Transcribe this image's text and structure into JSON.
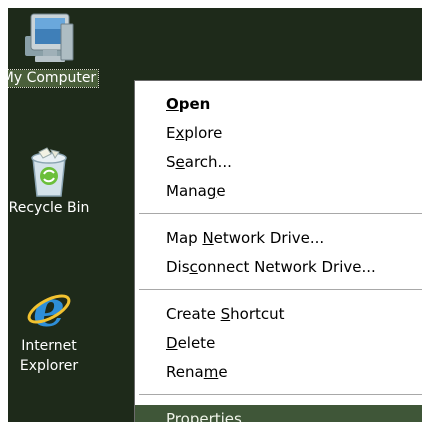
{
  "desktop": {
    "icons": [
      {
        "name": "my-computer",
        "label": "My Computer",
        "selected": true
      },
      {
        "name": "recycle-bin",
        "label": "Recycle Bin",
        "selected": false
      },
      {
        "name": "internet-explorer",
        "label_line1": "Internet",
        "label_line2": "Explorer",
        "selected": false
      }
    ]
  },
  "context_menu": {
    "groups": [
      [
        {
          "name": "open",
          "pre": "",
          "key": "O",
          "post": "pen",
          "bold": true
        },
        {
          "name": "explore",
          "pre": "E",
          "key": "x",
          "post": "plore"
        },
        {
          "name": "search",
          "pre": "S",
          "key": "e",
          "post": "arch..."
        },
        {
          "name": "manage",
          "pre": "Mana",
          "key": "g",
          "post": "e"
        }
      ],
      [
        {
          "name": "map-network-drive",
          "pre": "Map ",
          "key": "N",
          "post": "etwork Drive..."
        },
        {
          "name": "disconnect-network-drive",
          "pre": "Dis",
          "key": "c",
          "post": "onnect Network Drive..."
        }
      ],
      [
        {
          "name": "create-shortcut",
          "pre": "Create ",
          "key": "S",
          "post": "hortcut"
        },
        {
          "name": "delete",
          "pre": "",
          "key": "D",
          "post": "elete"
        },
        {
          "name": "rename",
          "pre": "Rena",
          "key": "m",
          "post": "e"
        }
      ],
      [
        {
          "name": "properties",
          "pre": "P",
          "key": "r",
          "post": "operties",
          "highlighted": true
        }
      ]
    ]
  },
  "colors": {
    "desktop_bg": "#1e2a1a",
    "menu_bg": "#ffffff",
    "highlight_bg": "#3f5638",
    "selection_label_bg": "#4a5f3a"
  }
}
